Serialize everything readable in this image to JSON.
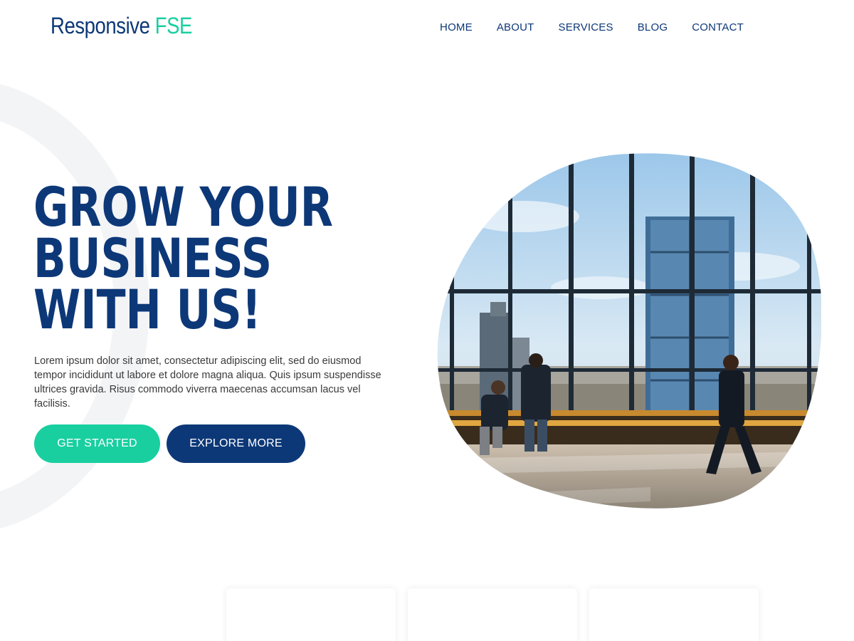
{
  "header": {
    "logo_part1": "Responsive",
    "logo_part2": "FSE",
    "nav": [
      "HOME",
      "ABOUT",
      "SERVICES",
      "BLOG",
      "CONTACT"
    ]
  },
  "hero": {
    "title": "GROW YOUR BUSINESS WITH US!",
    "description": "Lorem ipsum dolor sit amet, consectetur adipiscing elit, sed do eiusmod tempor incididunt ut labore et dolore magna aliqua. Quis ipsum suspendisse ultrices gravida. Risus commodo viverra maecenas accumsan lacus vel facilisis.",
    "primary_button": "GET STARTED",
    "secondary_button": "EXPLORE MORE"
  },
  "colors": {
    "navy": "#0d3878",
    "teal": "#19cfa0"
  }
}
